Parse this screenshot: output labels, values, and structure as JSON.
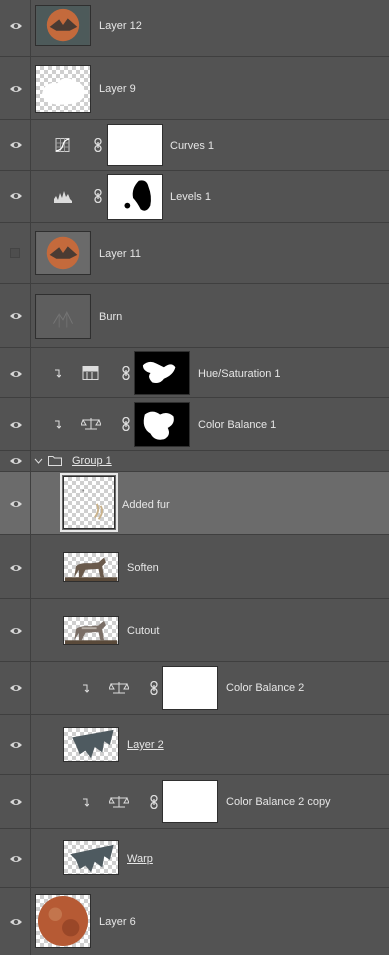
{
  "panel": "layers",
  "colors": {
    "panel_bg": "#535353",
    "selected_row_bg": "#6b6b6b",
    "divider": "#3f3f3f",
    "text": "#e6e6e6"
  },
  "layers": [
    {
      "name": "Layer 12",
      "visible": true,
      "kind": "pixel",
      "thumbnail": "creature-on-moon"
    },
    {
      "name": "Layer 9",
      "visible": true,
      "kind": "pixel",
      "thumbnail": "white-cloud"
    },
    {
      "name": "Curves 1",
      "visible": true,
      "kind": "adjustment",
      "icon": "curves-icon",
      "mask": "white"
    },
    {
      "name": "Levels 1",
      "visible": true,
      "kind": "adjustment",
      "icon": "levels-icon",
      "mask": "black-shape-on-white"
    },
    {
      "name": "Layer 11",
      "visible": false,
      "kind": "pixel",
      "thumbnail": "creature-on-moon"
    },
    {
      "name": "Burn",
      "visible": true,
      "kind": "pixel",
      "thumbnail": "gray-sketch"
    },
    {
      "name": "Hue/Saturation 1",
      "visible": true,
      "kind": "adjustment",
      "icon": "hue-saturation-icon",
      "clipped": true,
      "mask": "white-shape-on-black"
    },
    {
      "name": "Color Balance 1",
      "visible": true,
      "kind": "adjustment",
      "icon": "color-balance-icon",
      "clipped": true,
      "mask": "white-shape-on-black"
    },
    {
      "name": "Group 1",
      "visible": true,
      "kind": "group",
      "expanded": true,
      "icon": "folder-icon"
    },
    {
      "name": "Added fur",
      "visible": true,
      "kind": "pixel",
      "selected": true,
      "thumbnail": "fur-strokes"
    },
    {
      "name": "Soften",
      "visible": true,
      "kind": "pixel",
      "thumbnail": "wolf-silhouette"
    },
    {
      "name": "Cutout",
      "visible": true,
      "kind": "pixel",
      "thumbnail": "wolf"
    },
    {
      "name": "Color Balance 2",
      "visible": true,
      "kind": "adjustment",
      "icon": "color-balance-icon",
      "clipped": true,
      "mask": "white"
    },
    {
      "name": "Layer 2",
      "visible": true,
      "kind": "pixel",
      "thumbnail": "bat-wing"
    },
    {
      "name": "Color Balance 2 copy",
      "visible": true,
      "kind": "adjustment",
      "icon": "color-balance-icon",
      "clipped": true,
      "mask": "white"
    },
    {
      "name": "Warp",
      "visible": true,
      "kind": "pixel",
      "thumbnail": "bat-wing"
    },
    {
      "name": "Layer 6",
      "visible": true,
      "kind": "pixel",
      "thumbnail": "red-moon"
    }
  ]
}
